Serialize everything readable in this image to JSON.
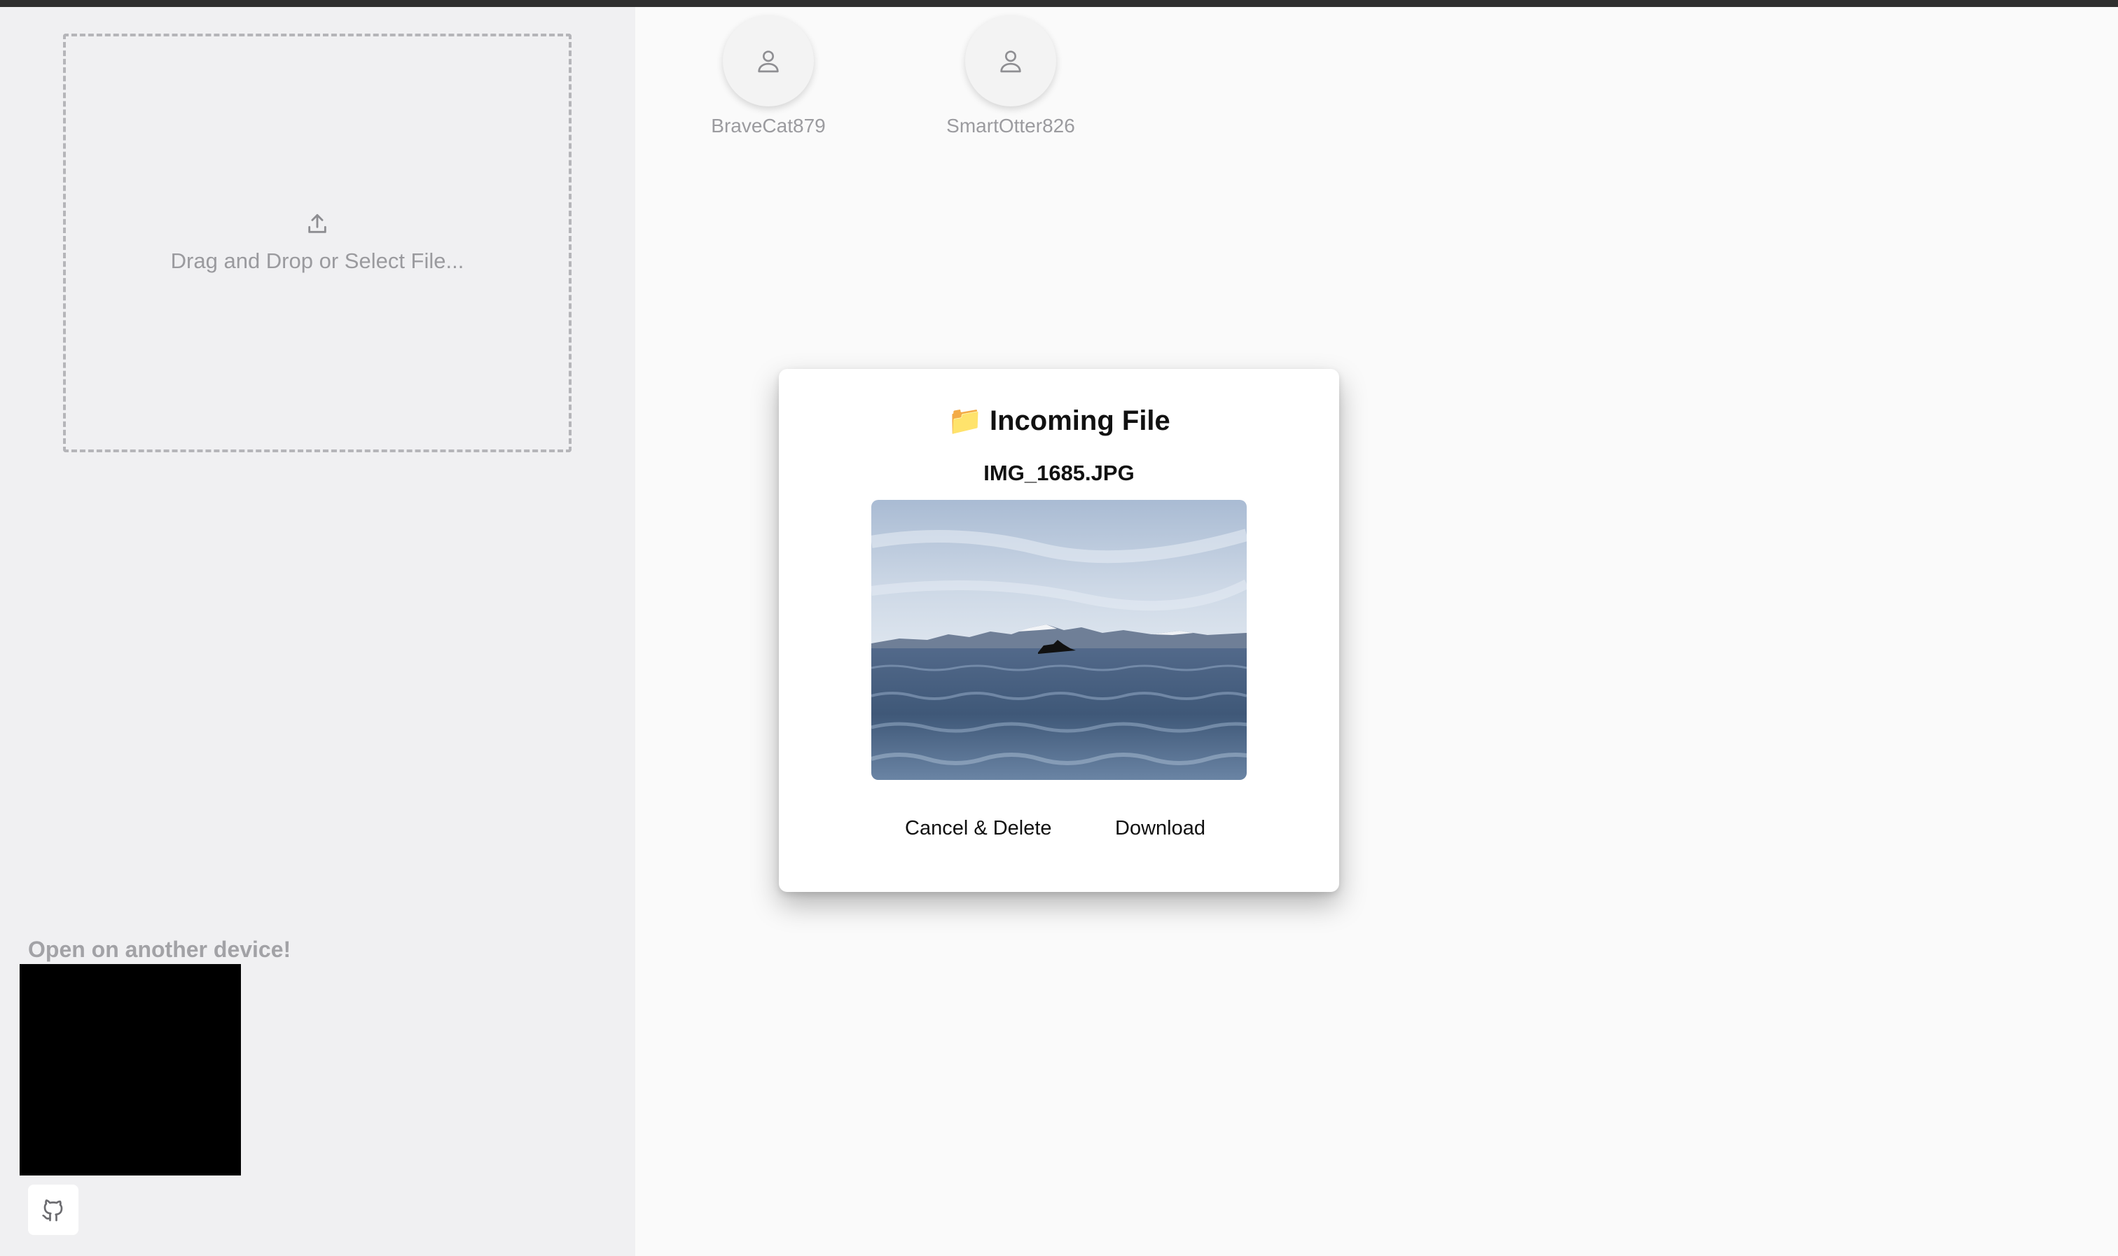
{
  "sidebar": {
    "dropzone_label": "Drag and Drop or Select File...",
    "qr_title": "Open on another device!",
    "github_icon": "github-icon",
    "upload_icon": "upload-icon"
  },
  "peers": [
    {
      "name": "BraveCat879",
      "icon": "user-icon"
    },
    {
      "name": "SmartOtter826",
      "icon": "user-icon"
    }
  ],
  "modal": {
    "title_emoji": "📁",
    "title": "Incoming File",
    "file_name": "IMG_1685.JPG",
    "cancel_label": "Cancel & Delete",
    "download_label": "Download"
  },
  "colors": {
    "topbar": "#2f2f2f",
    "sidebar_bg": "#f0f0f2",
    "main_bg": "#fafafa"
  }
}
